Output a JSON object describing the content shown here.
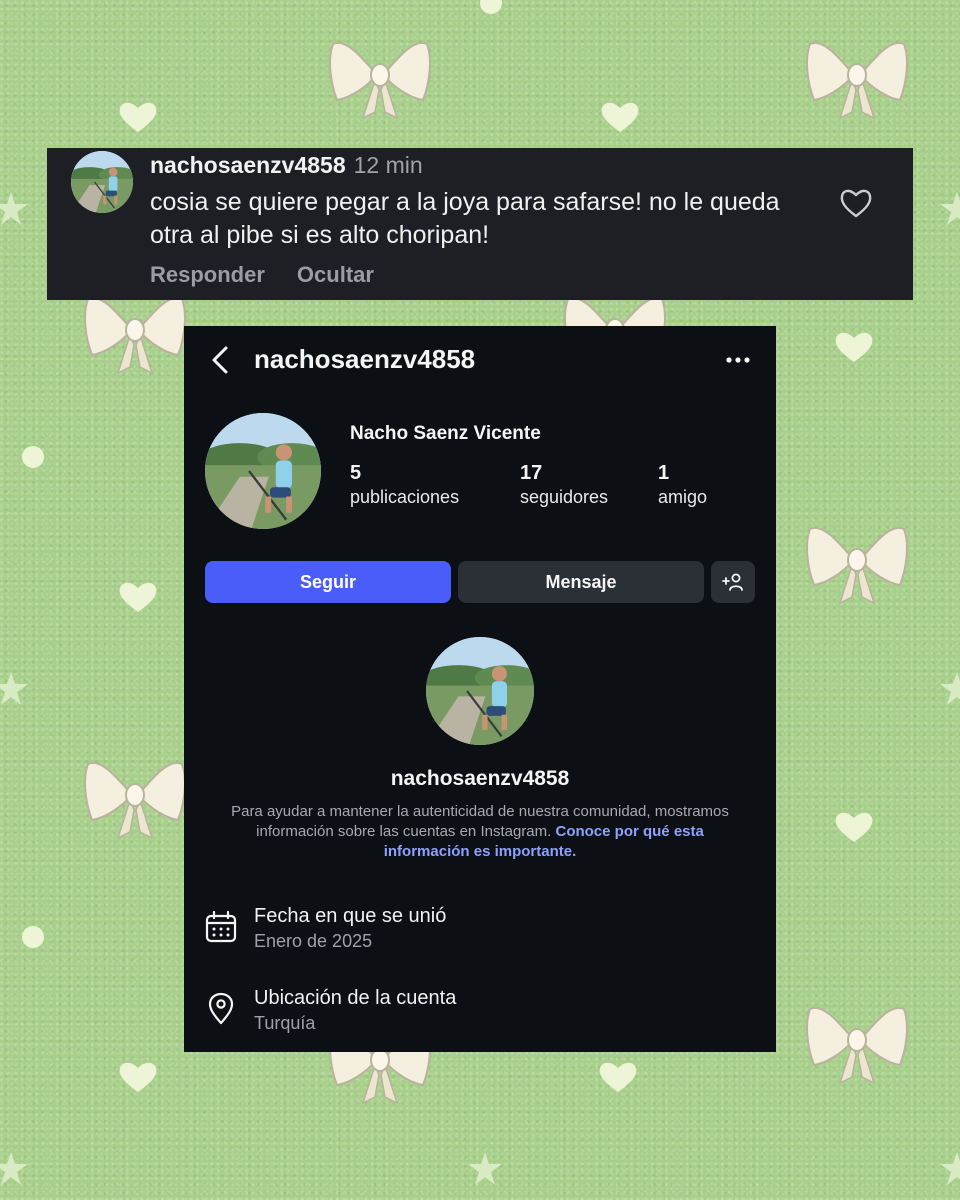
{
  "comment": {
    "username": "nachosaenzv4858",
    "time": "12 min",
    "text": "cosia se quiere pegar a la joya para safarse! no le queda otra al pibe si es alto choripan!",
    "actions": {
      "reply": "Responder",
      "hide": "Ocultar"
    },
    "like_icon": "heart-outline-icon"
  },
  "profile": {
    "header_username": "nachosaenzv4858",
    "full_name": "Nacho Saenz Vicente",
    "stats": [
      {
        "value": "5",
        "label": "publicaciones"
      },
      {
        "value": "17",
        "label": "seguidores"
      },
      {
        "value": "1",
        "label": "amigo"
      }
    ],
    "buttons": {
      "follow": "Seguir",
      "message": "Mensaje",
      "add_icon": "add-person-icon"
    },
    "about_username": "nachosaenzv4858",
    "info_text": "Para ayudar a mantener la autenticidad de nuestra comunidad, mostramos información sobre las cuentas en Instagram.",
    "info_link": "Conoce por qué esta información es importante.",
    "rows": [
      {
        "icon": "calendar-icon",
        "title": "Fecha en que se unió",
        "value": "Enero de 2025"
      },
      {
        "icon": "location-pin-icon",
        "title": "Ubicación de la cuenta",
        "value": "Turquía"
      }
    ]
  },
  "colors": {
    "background": "#a7cf8a",
    "card": "#0c0f14",
    "follow_button": "#4a5df9",
    "link": "#8da2ff"
  }
}
